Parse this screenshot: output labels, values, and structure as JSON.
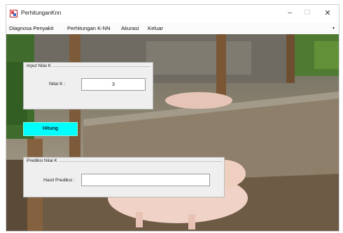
{
  "window": {
    "title": "PerhitunganKnn",
    "controls": {
      "minimize": "–",
      "maximize": "☐",
      "close": "✕"
    }
  },
  "menu": {
    "items": [
      "Diagnosa Penyakit",
      "Perhitungan K-NN",
      "Akurasi",
      "Keluar"
    ],
    "overflow": "▾"
  },
  "input_panel": {
    "title": "Input Nilai K",
    "field_label": "Nilai K :",
    "field_value": "3"
  },
  "hitung_button": {
    "label": "Hitung",
    "color": "#00ffff"
  },
  "prediction_panel": {
    "title": "Prediksi Nilai K",
    "field_label": "Hasil Prediksi :",
    "field_value": ""
  },
  "background": {
    "icon": "pig-pen-photo"
  }
}
